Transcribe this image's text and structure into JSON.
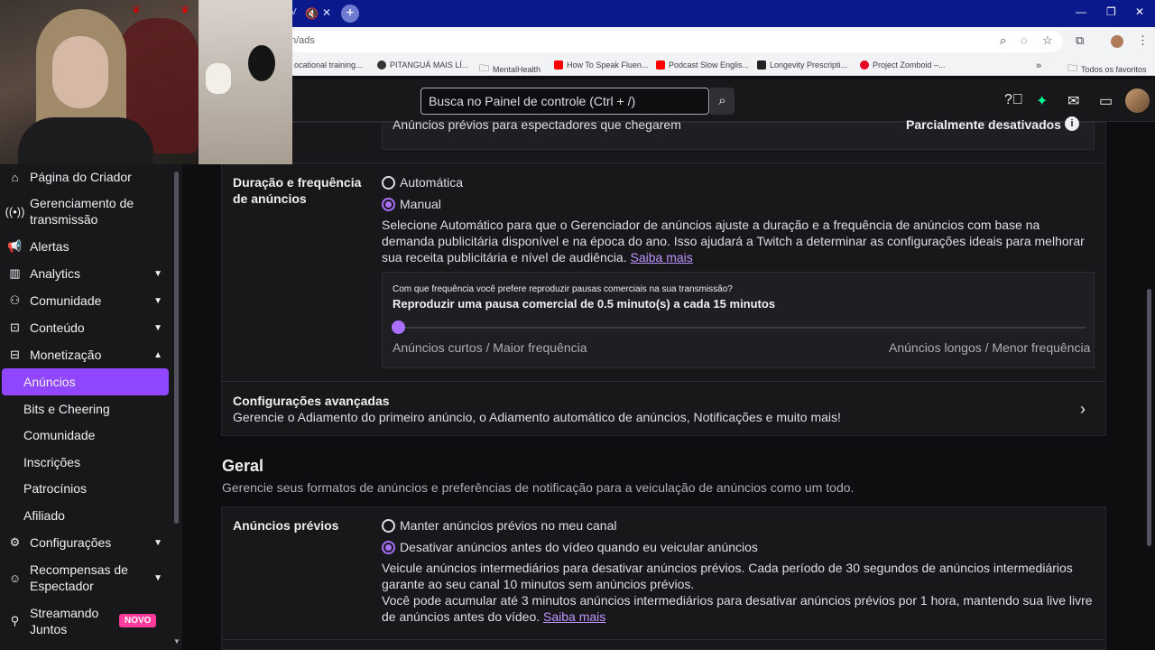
{
  "browser": {
    "tab_fragment": "V",
    "url": "n/ads",
    "bookmarks": [
      "ocational training...",
      "PITANGUÁ MAIS LÍ...",
      "MentalHealth",
      "How To Speak Fluen...",
      "Podcast Slow Englis...",
      "Longevity Prescripti...",
      "Project Zomboid –...",
      "Todos os favoritos"
    ]
  },
  "header": {
    "search_placeholder": "Busca no Painel de controle (Ctrl + /)"
  },
  "sidebar": {
    "items": [
      {
        "label": "Página do Criador"
      },
      {
        "label": "Gerenciamento de transmissão"
      },
      {
        "label": "Alertas"
      },
      {
        "label": "Analytics"
      },
      {
        "label": "Comunidade"
      },
      {
        "label": "Conteúdo"
      },
      {
        "label": "Monetização"
      }
    ],
    "sub_items": [
      "Anúncios",
      "Bits e Cheering",
      "Comunidade",
      "Inscrições",
      "Patrocínios",
      "Afiliado"
    ],
    "items2": [
      {
        "label": "Configurações"
      },
      {
        "label": "Recompensas de Espectador"
      },
      {
        "label": "Streamando Juntos"
      }
    ],
    "badge": "NOVO"
  },
  "main": {
    "top_row": {
      "text": "Anúncios prévios para espectadores que chegarem",
      "status": "Parcialmente desativados"
    },
    "duration": {
      "label": "Duração e frequência de anúncios",
      "option_auto": "Automática",
      "option_manual": "Manual",
      "description": "Selecione Automático para que o Gerenciador de anúncios ajuste a duração e a frequência de anúncios com base na demanda publicitária disponível e na época do ano. Isso ajudará a Twitch a determinar as configurações ideais para melhorar sua receita publicitária e nível de audiência.",
      "link": "Saiba mais",
      "slider_question": "Com que frequência você prefere reproduzir pausas comerciais na sua transmissão?",
      "slider_value_text": "Reproduzir uma pausa comercial de 0.5 minuto(s) a cada 15 minutos",
      "slider_level": 0.0,
      "slider_left": "Anúncios curtos / Maior frequência",
      "slider_right": "Anúncios longos / Menor frequência"
    },
    "advanced": {
      "title": "Configurações avançadas",
      "description": "Gerencie o Adiamento do primeiro anúncio, o Adiamento automático de anúncios, Notificações e muito mais!"
    },
    "general": {
      "title": "Geral",
      "description": "Gerencie seus formatos de anúncios e preferências de notificação para a veiculação de anúncios como um todo."
    },
    "preroll": {
      "label": "Anúncios prévios",
      "option_keep": "Manter anúncios prévios no meu canal",
      "option_disable": "Desativar anúncios antes do vídeo quando eu veicular anúncios",
      "desc1": "Veicule anúncios intermediários para desativar anúncios prévios. Cada período de 30 segundos de anúncios intermediários garante ao seu canal 10 minutos sem anúncios prévios.",
      "desc2": "Você pode acumular até 3 minutos anúncios intermediários para desativar anúncios prévios por 1 hora, mantendo sua live livre de anúncios antes do vídeo.",
      "link": "Saiba mais"
    }
  },
  "colors": {
    "accent": "#9147ff",
    "accent_light": "#a970ff",
    "link": "#bf94ff",
    "badge": "#ff3c9d"
  }
}
